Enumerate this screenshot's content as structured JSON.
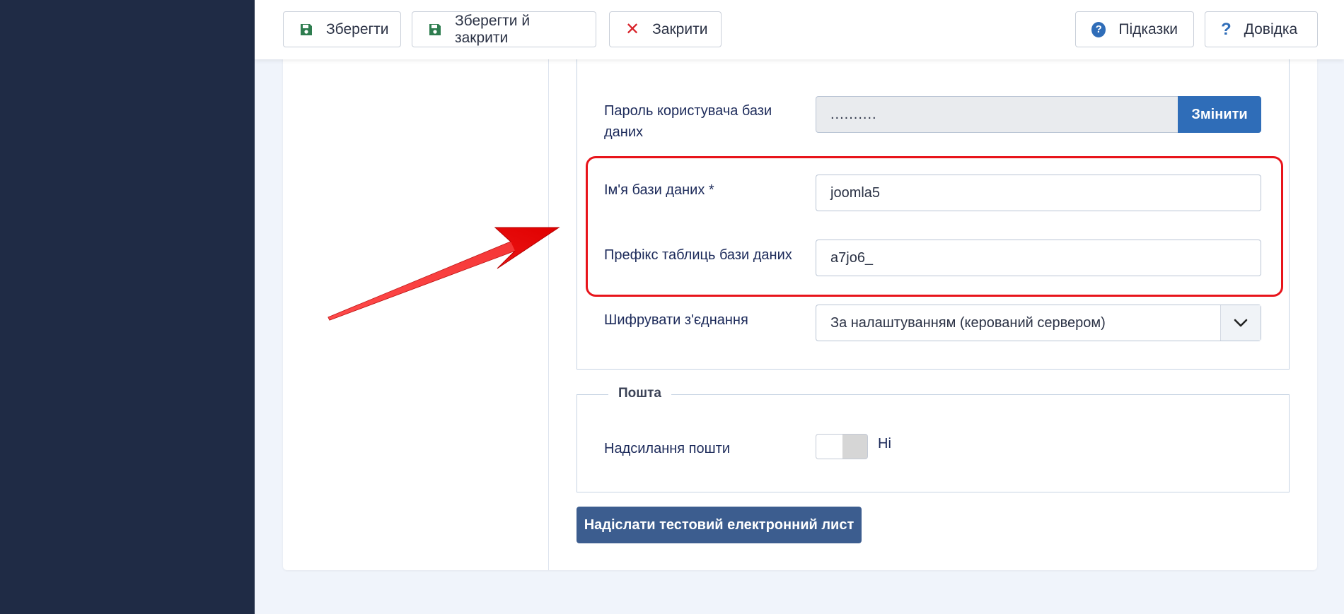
{
  "toolbar": {
    "save_label": "Зберегти",
    "save_close_label": "Зберегти й закрити",
    "close_label": "Закрити",
    "hints_label": "Підказки",
    "help_label": "Довідка"
  },
  "database": {
    "password_label_line1": "Пароль користувача бази",
    "password_label_line2": "даних",
    "password_value": "..........",
    "change_button": "Змінити",
    "db_name_label": "Ім'я бази даних *",
    "db_name_value": "joomla5",
    "prefix_label": "Префікс таблиць бази даних",
    "prefix_value": "a7jo6_",
    "encrypt_label": "Шифрувати з'єднання",
    "encrypt_value": "За налаштуванням (керований сервером)"
  },
  "mail": {
    "legend": "Пошта",
    "send_label": "Надсилання пошти",
    "send_value": "Ні",
    "send_enabled": false,
    "test_button": "Надіслати тестовий електронний лист"
  },
  "colors": {
    "sidebar": "#1f2b45",
    "primary": "#2f6db8",
    "highlight": "#e8141b",
    "test_button": "#3c5d8f"
  }
}
